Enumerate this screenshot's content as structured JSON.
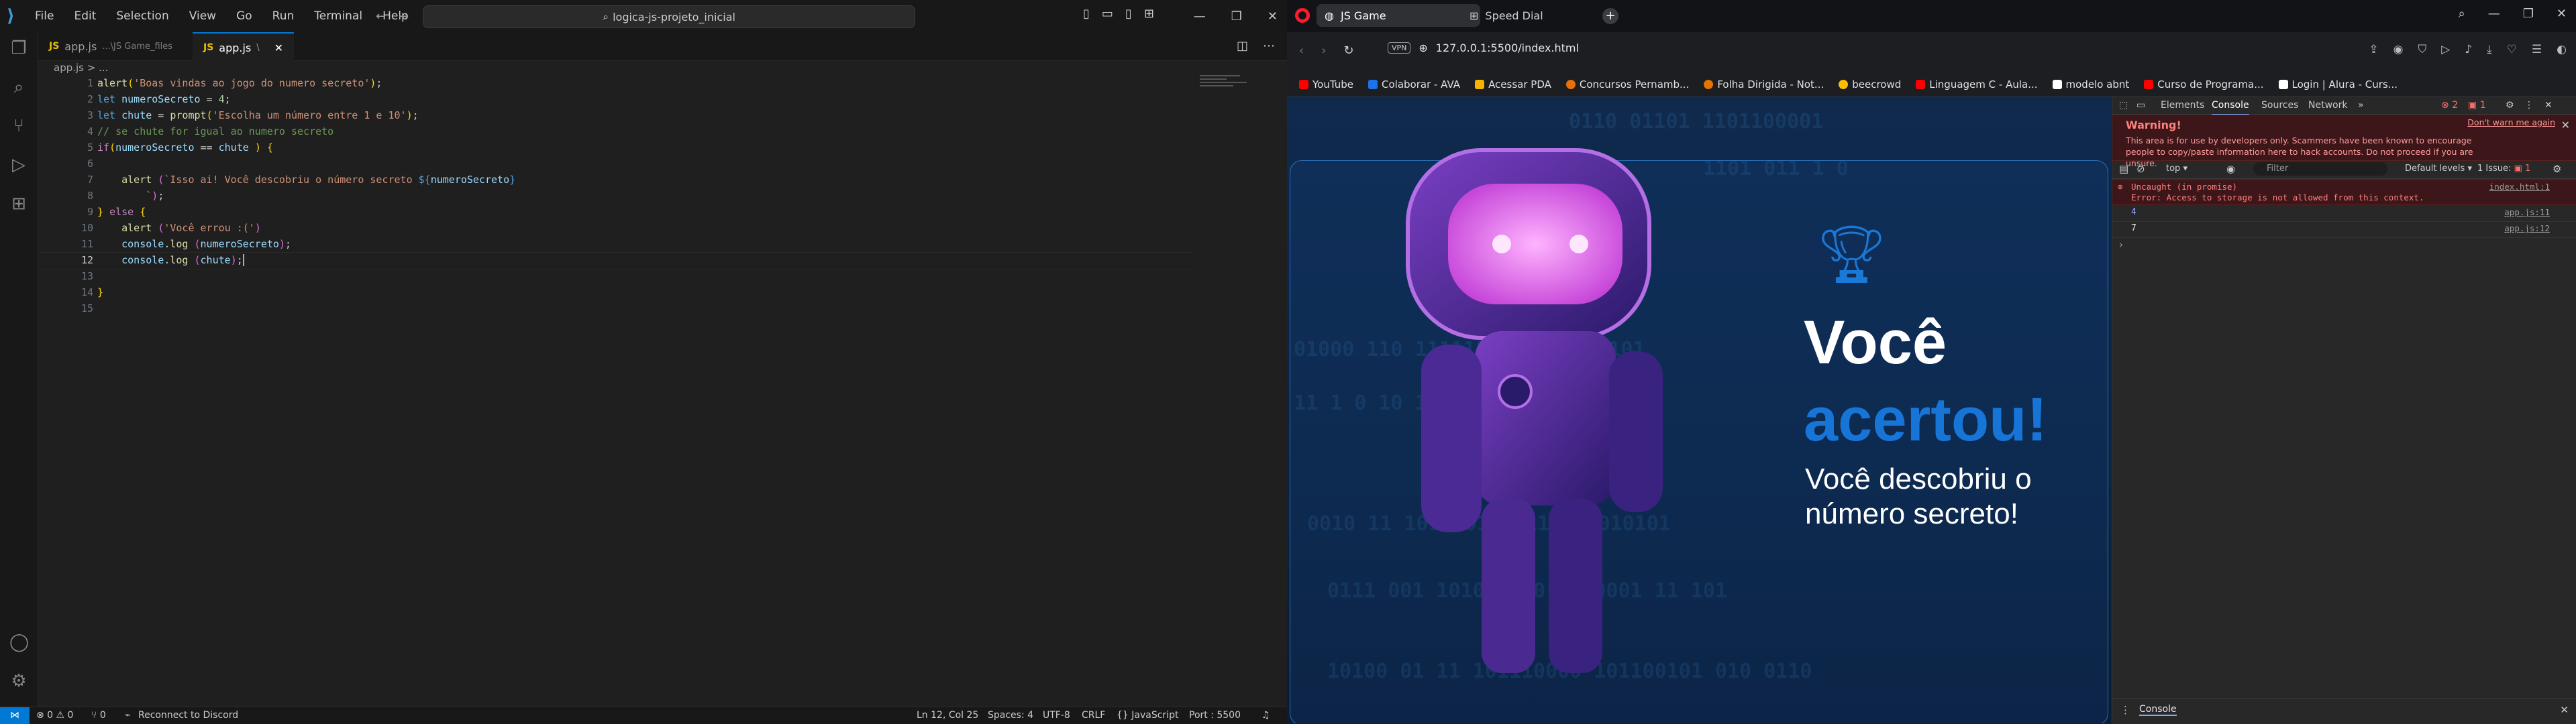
{
  "vscode": {
    "menu": [
      "File",
      "Edit",
      "Selection",
      "View",
      "Go",
      "Run",
      "Terminal",
      "Help"
    ],
    "command_center": "logica-js-projeto_inicial",
    "tabs": [
      {
        "label": "app.js",
        "detail": "...\\JS Game_files"
      },
      {
        "label": "app.js",
        "detail": "\\"
      }
    ],
    "breadcrumb": "app.js > ...",
    "line_numbers": [
      "1",
      "2",
      "3",
      "4",
      "5",
      "6",
      "7",
      "8",
      "9",
      "10",
      "11",
      "12",
      "13",
      "14",
      "15"
    ],
    "status": {
      "errors": "⊗ 0 ⚠ 0",
      "ports": "⑂ 0",
      "reconnect": "Reconnect to Discord",
      "position": "Ln 12, Col 25",
      "spaces": "Spaces: 4",
      "encoding": "UTF-8",
      "eol": "CRLF",
      "language": "{} JavaScript",
      "port": "Port : 5500"
    }
  },
  "opera": {
    "tabs": [
      {
        "label": "JS Game"
      },
      {
        "label": "Speed Dial"
      }
    ],
    "url": "127.0.0.1:5500/index.html",
    "vpn": "VPN",
    "bookmarks": [
      {
        "label": "YouTube",
        "color": "#ff0000"
      },
      {
        "label": "Colaborar - AVA",
        "color": "#1a73e8"
      },
      {
        "label": "Acessar PDA",
        "color": "#f4b400"
      },
      {
        "label": "Concursos Pernamb...",
        "color": "#e8710a"
      },
      {
        "label": "Folha Dirigida - Not...",
        "color": "#e37400"
      },
      {
        "label": "beecrowd",
        "color": "#fbbc04"
      },
      {
        "label": "Linguagem C - Aula...",
        "color": "#ff0000"
      },
      {
        "label": "modelo abnt",
        "color": "#ffffff"
      },
      {
        "label": "Curso de Programa...",
        "color": "#ff0000"
      },
      {
        "label": "Login | Alura - Curs...",
        "color": "#ffffff"
      }
    ],
    "page": {
      "line1": "Você",
      "line2": "acertou!",
      "subtitle": "Você descobriu o número secreto!"
    },
    "devtools": {
      "tabs": [
        "Elements",
        "Console",
        "Sources",
        "Network"
      ],
      "error_count": "2",
      "issue_badge": "1",
      "warning_title": "Warning!",
      "warning_text": "This area is for use by developers only. Scammers have been known to encourage people to copy/paste information here to hack accounts. Do not proceed if you are unsure.",
      "warning_link": "Don't warn me again",
      "context": "top",
      "filter_placeholder": "Filter",
      "levels": "Default levels",
      "issues": "1 Issue:",
      "issues_count": "1",
      "error_line1": "Uncaught (in promise)",
      "error_line2": "Error: Access to storage is not allowed from this context.",
      "error_src": "index.html:1",
      "logs": [
        {
          "value": "4",
          "src": "app.js:11"
        },
        {
          "value": "7",
          "src": "app.js:12"
        }
      ],
      "drawer_tab": "Console"
    }
  }
}
